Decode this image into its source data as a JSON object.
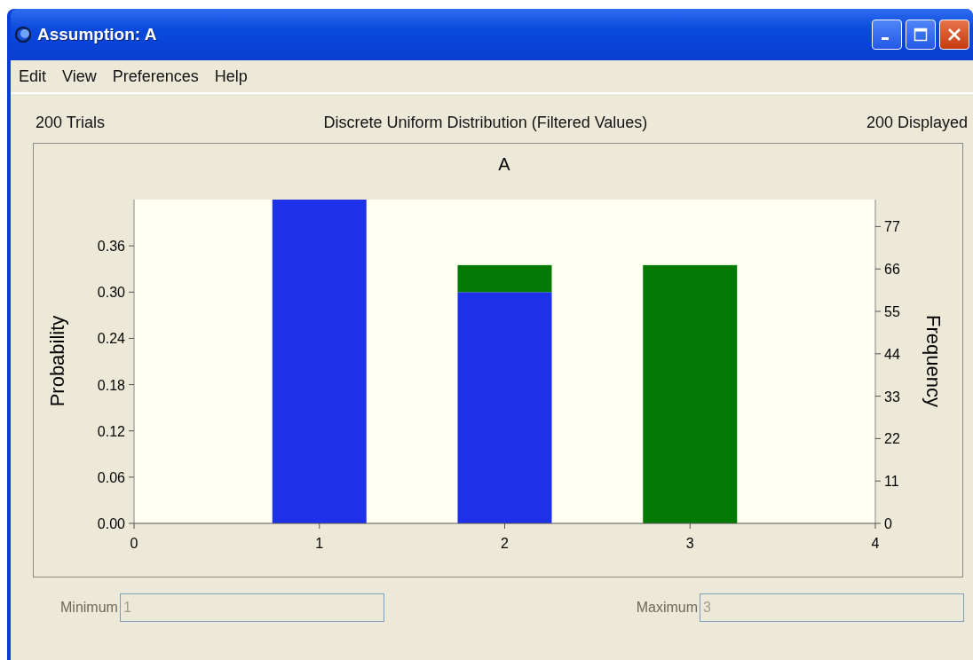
{
  "window": {
    "title": "Assumption: A"
  },
  "menu": [
    "Edit",
    "View",
    "Preferences",
    "Help"
  ],
  "header": {
    "trials": "200 Trials",
    "distribution": "Discrete Uniform Distribution (Filtered Values)",
    "displayed": "200 Displayed"
  },
  "chart": {
    "secondary_axis": {
      "title": "Frequency",
      "ticks": [
        "77",
        "66",
        "55",
        "44",
        "33",
        "22",
        "11",
        "0"
      ]
    },
    "chart_data": {
      "type": "bar",
      "title": "A",
      "ylabel": "Probability",
      "x": [
        1,
        2,
        3
      ],
      "xlim": [
        0,
        4
      ],
      "xticks": [
        0,
        1,
        2,
        3,
        4
      ],
      "ylim": [
        0,
        0.42
      ],
      "yticks": [
        {
          "value": 0,
          "label": "0.00"
        },
        {
          "value": 0.06,
          "label": "0.06"
        },
        {
          "value": 0.12,
          "label": "0.12"
        },
        {
          "value": 0.18,
          "label": "0.18"
        },
        {
          "value": 0.24,
          "label": "0.24"
        },
        {
          "value": 0.3,
          "label": "0.30"
        },
        {
          "value": 0.36,
          "label": "0.36"
        }
      ],
      "stacked": true,
      "series": [
        {
          "color": "#1c31e8",
          "values": [
            0.42,
            0.3,
            0
          ]
        },
        {
          "color": "#047a04",
          "values": [
            0,
            0.035,
            0.335
          ]
        }
      ]
    }
  },
  "fields": [
    {
      "label": "Minimum",
      "value": "1",
      "disabled": true
    },
    {
      "label": "Maximum",
      "value": "3",
      "disabled": true
    }
  ]
}
